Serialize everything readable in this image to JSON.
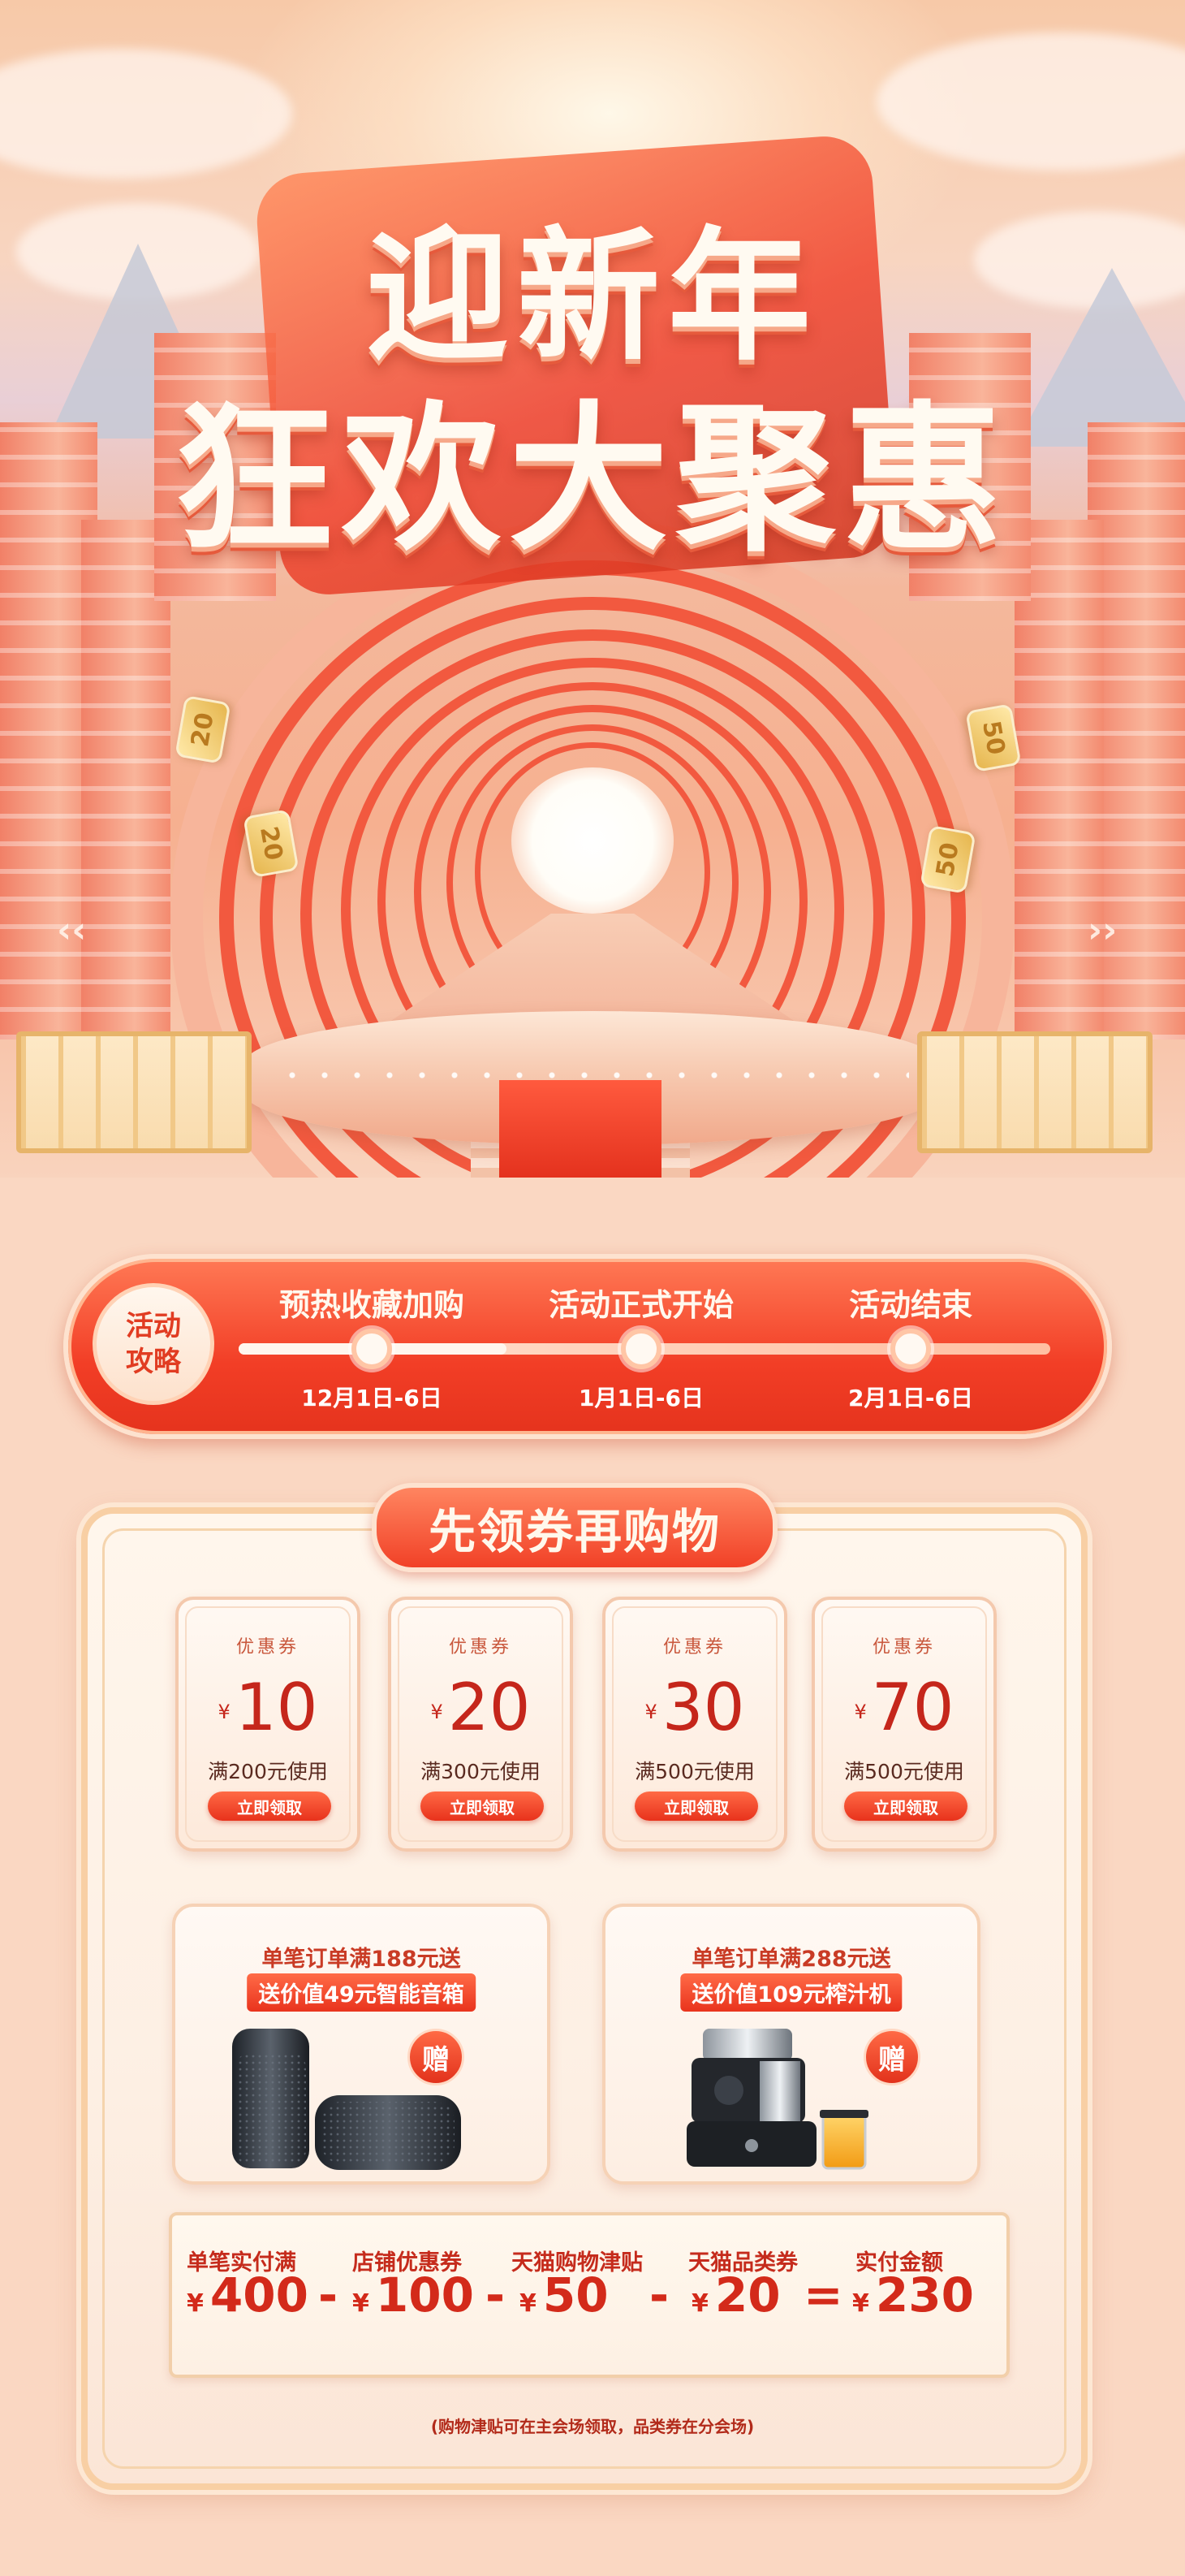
{
  "hero": {
    "title_line1": "迎新年",
    "title_line2": "狂欢大聚惠",
    "coins": [
      "20",
      "20",
      "50",
      "50"
    ]
  },
  "timeline": {
    "badge_line1": "活动",
    "badge_line2": "攻略",
    "steps": [
      {
        "label": "预热收藏加购",
        "date": "12月1日-6日"
      },
      {
        "label": "活动正式开始",
        "date": "1月1日-6日"
      },
      {
        "label": "活动结束",
        "date": "2月1日-6日"
      }
    ]
  },
  "coupons_section": {
    "title": "先领券再购物",
    "coupons": [
      {
        "label": "优惠券",
        "currency": "¥",
        "amount": "10",
        "condition": "满200元使用",
        "button": "立即领取"
      },
      {
        "label": "优惠券",
        "currency": "¥",
        "amount": "20",
        "condition": "满300元使用",
        "button": "立即领取"
      },
      {
        "label": "优惠券",
        "currency": "¥",
        "amount": "30",
        "condition": "满500元使用",
        "button": "立即领取"
      },
      {
        "label": "优惠券",
        "currency": "¥",
        "amount": "70",
        "condition": "满500元使用",
        "button": "立即领取"
      }
    ]
  },
  "gifts": [
    {
      "line1": "单笔订单满188元送",
      "line2": "送价值49元智能音箱",
      "tag": "赠"
    },
    {
      "line1": "单笔订单满288元送",
      "line2": "送价值109元榨汁机",
      "tag": "赠"
    }
  ],
  "calculation": {
    "items": [
      {
        "label": "单笔实付满",
        "currency": "¥",
        "value": "400"
      },
      {
        "label": "店铺优惠券",
        "currency": "¥",
        "value": "100"
      },
      {
        "label": "天猫购物津贴",
        "currency": "¥",
        "value": "50"
      },
      {
        "label": "天猫品类券",
        "currency": "¥",
        "value": "20"
      },
      {
        "label": "实付金额",
        "currency": "¥",
        "value": "230"
      }
    ],
    "operators": [
      "-",
      "-",
      "-",
      "="
    ]
  },
  "footnote": "(购物津贴可在主会场领取，品类券在分会场)",
  "colors": {
    "accent_red": "#f23e26",
    "background_peach": "#fad7c2",
    "price_red": "#d32a1a"
  }
}
